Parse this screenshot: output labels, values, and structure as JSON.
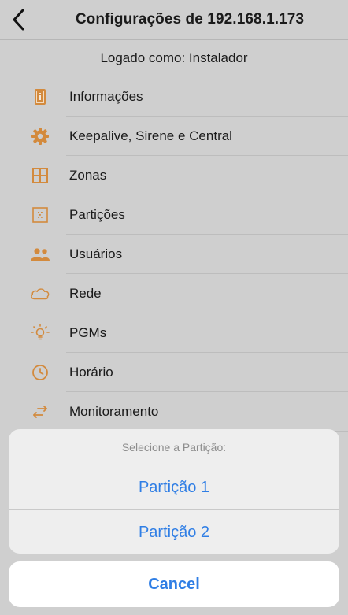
{
  "header": {
    "title": "Configurações de 192.168.1.173",
    "back_icon": "chevron-left-icon"
  },
  "logged_as": "Logado como: Instalador",
  "colors": {
    "accent_orange": "#d38a3d",
    "action_blue": "#2f7ee5"
  },
  "menu": {
    "items": [
      {
        "label": "Informações",
        "icon": "info-icon"
      },
      {
        "label": "Keepalive, Sirene e Central",
        "icon": "gear-icon"
      },
      {
        "label": "Zonas",
        "icon": "zones-grid-icon"
      },
      {
        "label": "Partições",
        "icon": "partition-icon"
      },
      {
        "label": "Usuários",
        "icon": "users-icon"
      },
      {
        "label": "Rede",
        "icon": "cloud-icon"
      },
      {
        "label": "PGMs",
        "icon": "lightbulb-icon"
      },
      {
        "label": "Horário",
        "icon": "clock-icon"
      },
      {
        "label": "Monitoramento",
        "icon": "arrows-swap-icon"
      }
    ]
  },
  "action_sheet": {
    "title": "Selecione a Partição:",
    "options": [
      "Partição 1",
      "Partição 2"
    ],
    "cancel_label": "Cancel"
  }
}
